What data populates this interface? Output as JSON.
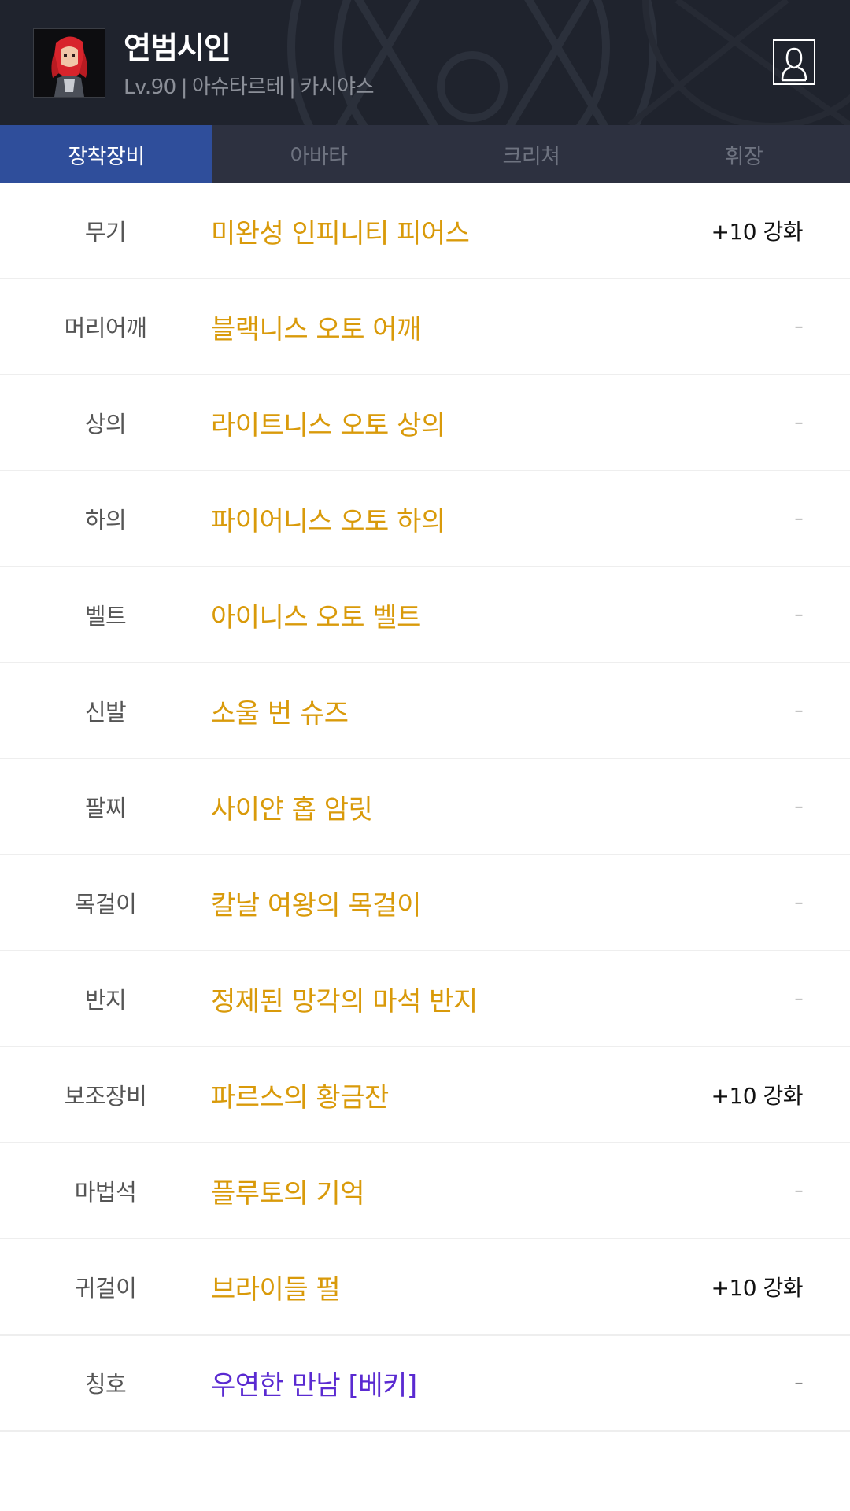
{
  "character": {
    "name": "연범시인",
    "level": "Lv.90",
    "job": "아슈타르테",
    "server": "카시야스",
    "separator": "|"
  },
  "tabs": [
    {
      "label": "장착장비",
      "active": true
    },
    {
      "label": "아바타",
      "active": false
    },
    {
      "label": "크리쳐",
      "active": false
    },
    {
      "label": "휘장",
      "active": false
    }
  ],
  "equipment": [
    {
      "slot": "무기",
      "item": "미완성 인피니티 피어스",
      "enhance": "+10 강화",
      "color": "#d99a0a"
    },
    {
      "slot": "머리어깨",
      "item": "블랙니스 오토 어깨",
      "enhance": "–",
      "color": "#d99a0a"
    },
    {
      "slot": "상의",
      "item": "라이트니스 오토 상의",
      "enhance": "–",
      "color": "#d99a0a"
    },
    {
      "slot": "하의",
      "item": "파이어니스 오토 하의",
      "enhance": "–",
      "color": "#d99a0a"
    },
    {
      "slot": "벨트",
      "item": "아이니스 오토 벨트",
      "enhance": "–",
      "color": "#d99a0a"
    },
    {
      "slot": "신발",
      "item": "소울 번 슈즈",
      "enhance": "–",
      "color": "#d99a0a"
    },
    {
      "slot": "팔찌",
      "item": "사이얀 홉 암릿",
      "enhance": "–",
      "color": "#d99a0a"
    },
    {
      "slot": "목걸이",
      "item": "칼날 여왕의 목걸이",
      "enhance": "–",
      "color": "#d99a0a"
    },
    {
      "slot": "반지",
      "item": "정제된 망각의 마석 반지",
      "enhance": "–",
      "color": "#d99a0a"
    },
    {
      "slot": "보조장비",
      "item": "파르스의 황금잔",
      "enhance": "+10 강화",
      "color": "#d99a0a"
    },
    {
      "slot": "마법석",
      "item": "플루토의 기억",
      "enhance": "–",
      "color": "#d99a0a"
    },
    {
      "slot": "귀걸이",
      "item": "브라이들 펄",
      "enhance": "+10 강화",
      "color": "#d99a0a"
    },
    {
      "slot": "칭호",
      "item": "우연한 만남 [베키]",
      "enhance": "–",
      "color": "#5a2ad1"
    }
  ],
  "icons": {
    "avatar": "character-portrait",
    "profile": "profile-icon"
  }
}
